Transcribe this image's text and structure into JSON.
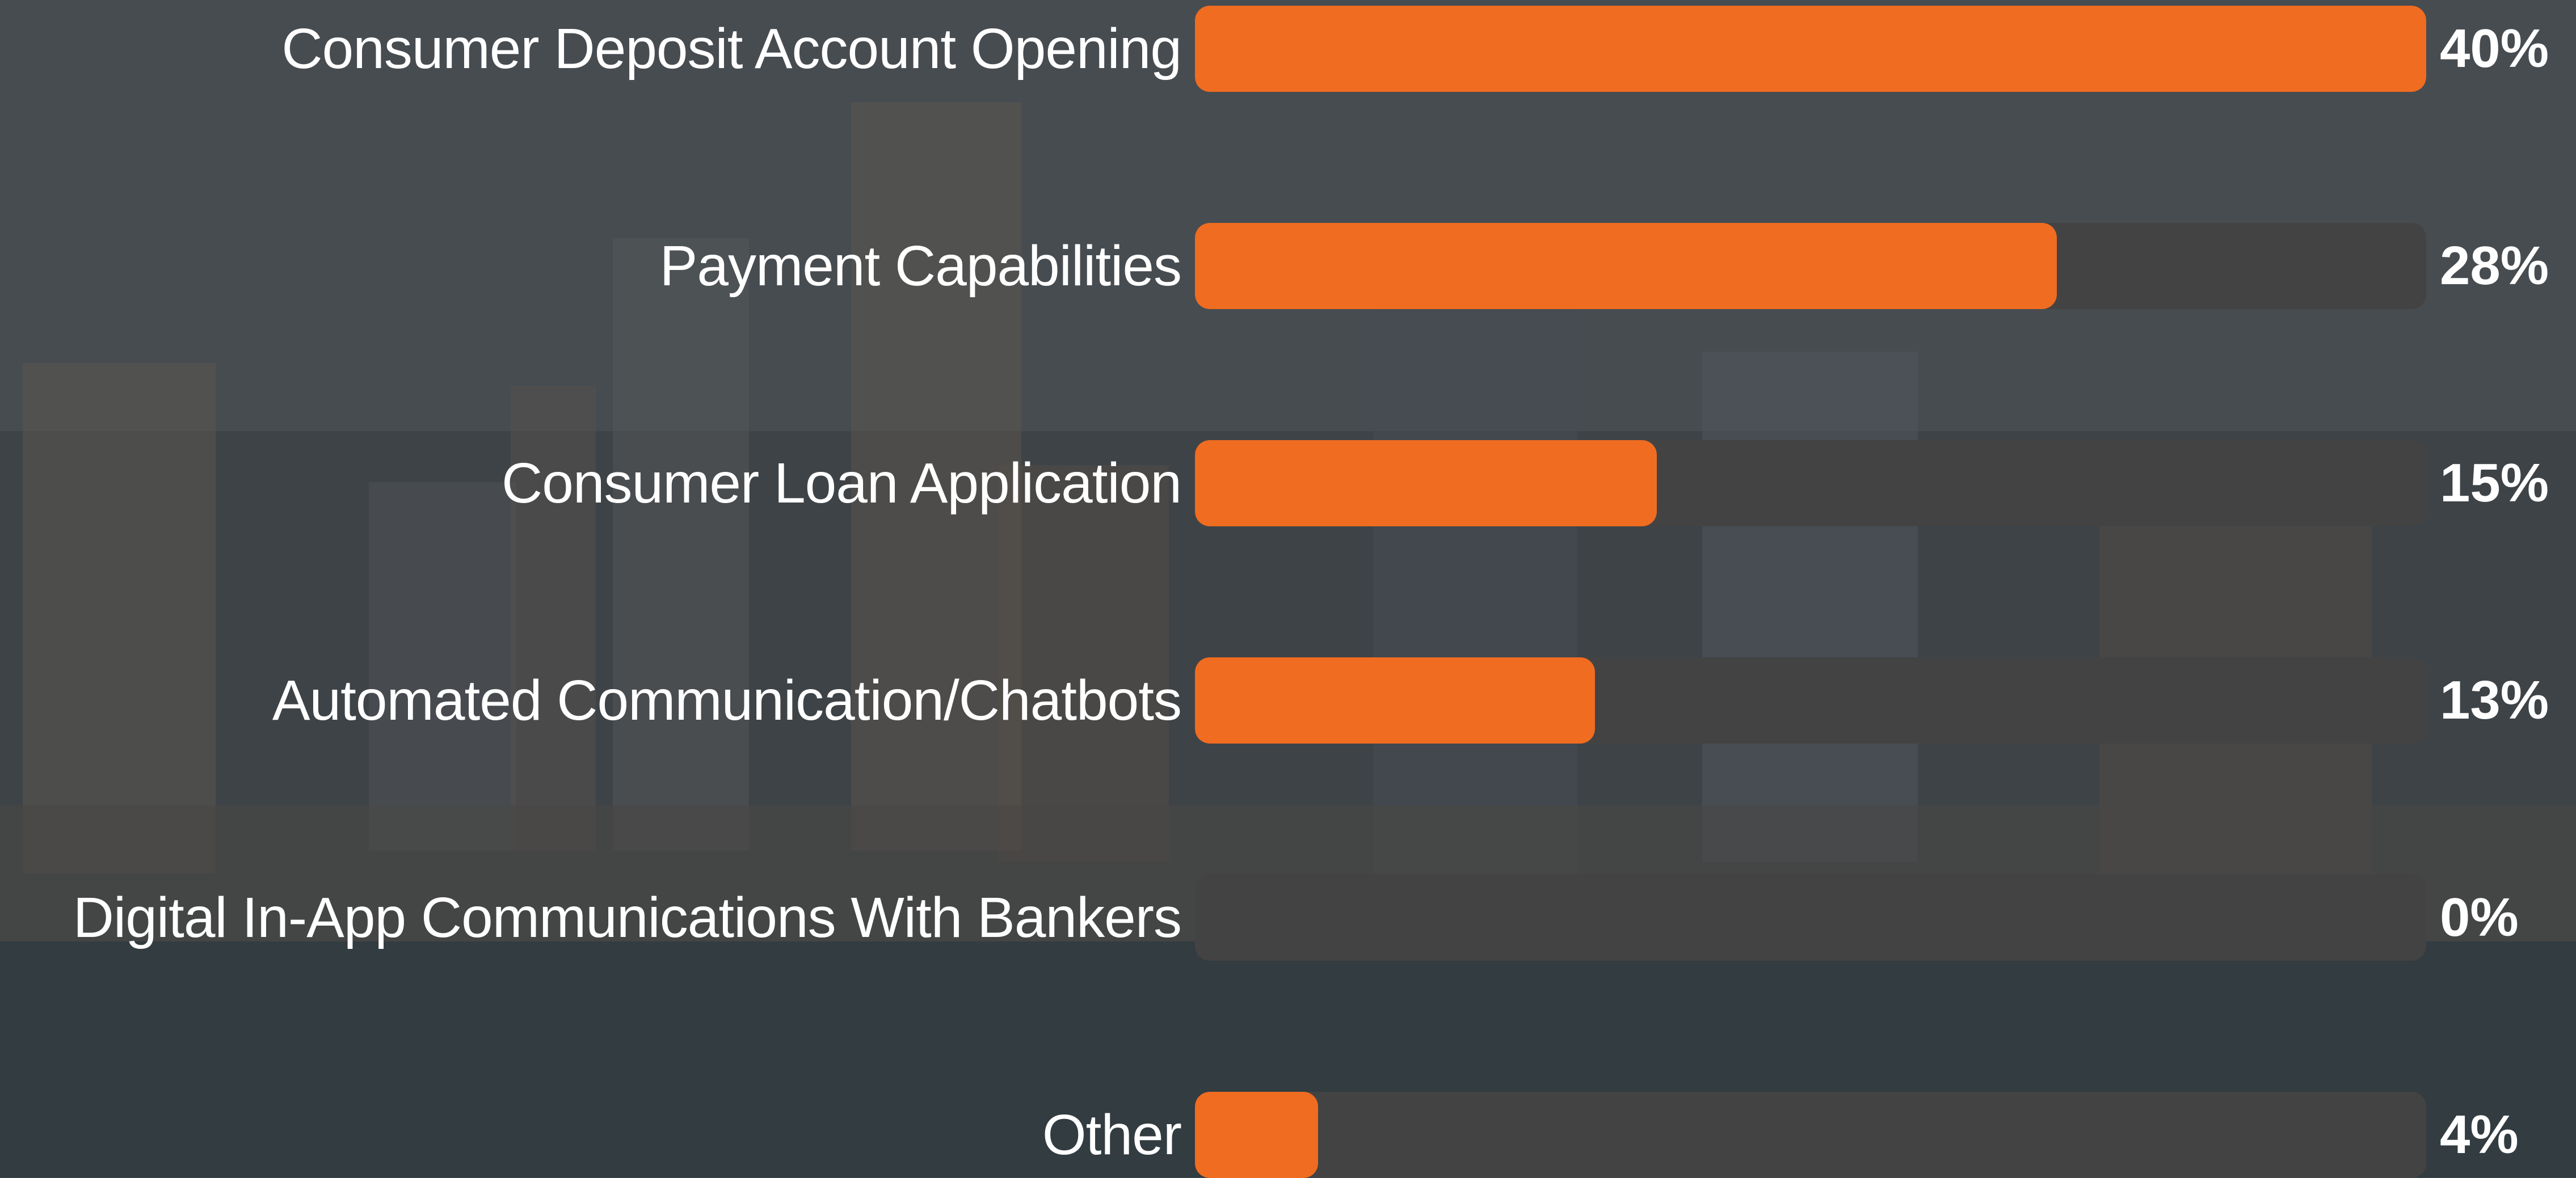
{
  "chart_data": {
    "type": "bar",
    "orientation": "horizontal",
    "categories": [
      "Consumer Deposit Account Opening",
      "Payment Capabilities",
      "Consumer Loan Application",
      "Automated Communication/Chatbots",
      "Digital In-App Communications With Bankers",
      "Other"
    ],
    "values": [
      40,
      28,
      15,
      13,
      0,
      4
    ],
    "value_labels": [
      "40%",
      "28%",
      "15%",
      "13%",
      "0%",
      "4%"
    ],
    "xlim": [
      0,
      40
    ],
    "grid": false,
    "title": "",
    "xlabel": "",
    "ylabel": ""
  },
  "colors": {
    "bar": "#ef6c21",
    "track": "#434343",
    "text": "#ffffff"
  }
}
